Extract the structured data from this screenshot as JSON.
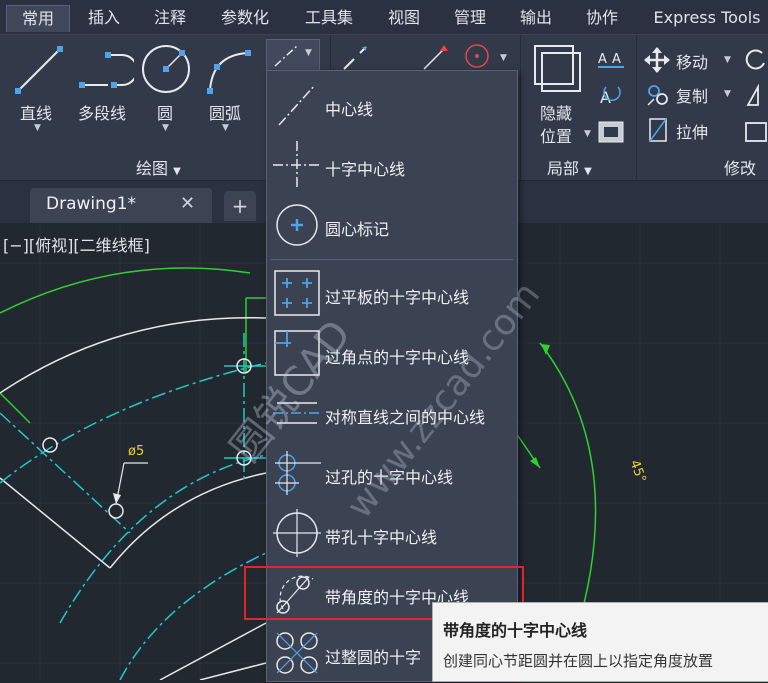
{
  "menu": {
    "tabs": [
      "常用",
      "插入",
      "注释",
      "参数化",
      "工具集",
      "视图",
      "管理",
      "输出",
      "协作",
      "Express Tools"
    ]
  },
  "ribbon": {
    "draw": {
      "tools": [
        "直线",
        "多段线",
        "圆",
        "圆弧"
      ],
      "title": "绘图"
    },
    "block": {
      "hide_label_1": "隐藏",
      "hide_label_2": "位置",
      "title": "局部"
    },
    "modify": {
      "tools": [
        "移动",
        "复制",
        "拉伸"
      ],
      "title": "修改"
    }
  },
  "doc": {
    "tab_name": "Drawing1*",
    "close": "✕",
    "add": "+"
  },
  "viewport": {
    "label": "[−][俯视][二维线框]"
  },
  "annotations": {
    "dim_hole": "ø5",
    "dim_angle": "45°"
  },
  "dropdown": {
    "items": [
      "中心线",
      "十字中心线",
      "圆心标记",
      "过平板的十字中心线",
      "过角点的十字中心线",
      "对称直线之间的中心线",
      "过孔的十字中心线",
      "带孔十字中心线",
      "带角度的十字中心线",
      "过整圆的十字"
    ]
  },
  "tooltip": {
    "title": "带角度的十字中心线",
    "description": "创建同心节距圆并在圆上以指定角度放置"
  },
  "watermark": {
    "line1": "圆锐CAD",
    "line2": "www.zzcad.com"
  },
  "colors": {
    "accent_blue": "#4fa3e8",
    "highlight_red": "#e8212e",
    "drawing_green": "#2fd12f",
    "drawing_cyan": "#22c8c8"
  }
}
